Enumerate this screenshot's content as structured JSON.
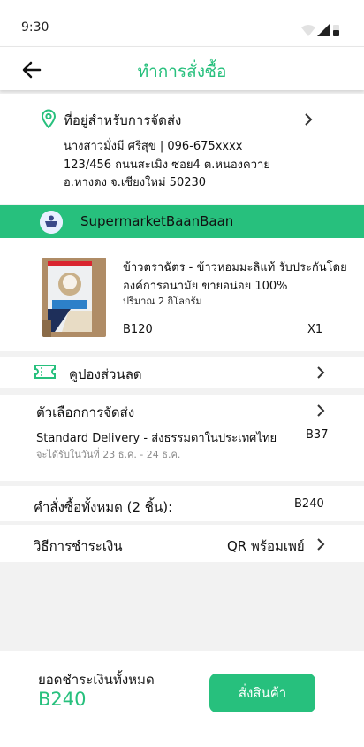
{
  "status_bar": {
    "time": "9:30"
  },
  "header": {
    "title": "ทำการสั่งซื้อ"
  },
  "address": {
    "title": "ที่อยู่สำหรับการจัดส่ง",
    "line1": "นางสาวมั่งมี ศรีสุข | 096-675xxxx",
    "line2": "123/456 ถนนสะเมิง ซอย4 ต.หนองควาย",
    "line3": "อ.หางดง จ.เชียงใหม่ 50230"
  },
  "shop": {
    "name": "SupermarketBaanBaan"
  },
  "product": {
    "name_line1": "ข้าวตราฉัตร - ข้าวหอมมะลิแท้ รับประกันโดย",
    "name_line2": "องค์การอนามัย ขายอน่อย 100%",
    "size": "ปริมาณ 2 กิโลกรัม",
    "price": "B120",
    "quantity": "X1"
  },
  "coupon": {
    "label": "คูปองส่วนลด"
  },
  "shipping": {
    "title": "ตัวเลือกการจัดส่ง",
    "method": "Standard Delivery  - ส่งธรรมดาในประเทศไทย",
    "price": "B37",
    "eta": "จะได้รับในวันที่ 23 ธ.ค.  - 24 ธ.ค."
  },
  "order_total": {
    "label": "คำสั่งซื้อทั้งหมด (2 ชิ้น):",
    "value": "B240"
  },
  "payment": {
    "label": "วิธีการชำระเงิน",
    "value": "QR พร้อมเพย์"
  },
  "footer": {
    "grand_total_label": "ยอดชำระเงินทั้งหมด",
    "grand_total_value": "B240",
    "order_button": "สั่งสินค้า"
  },
  "colors": {
    "accent": "#27c07d",
    "background": "#f2f2f2",
    "surface": "#ffffff"
  },
  "icons": [
    "wifi-icon",
    "signal-icon",
    "battery-icon",
    "back-arrow-icon",
    "location-pin-icon",
    "chevron-right-icon",
    "shop-avatar-icon",
    "coupon-ticket-icon"
  ]
}
